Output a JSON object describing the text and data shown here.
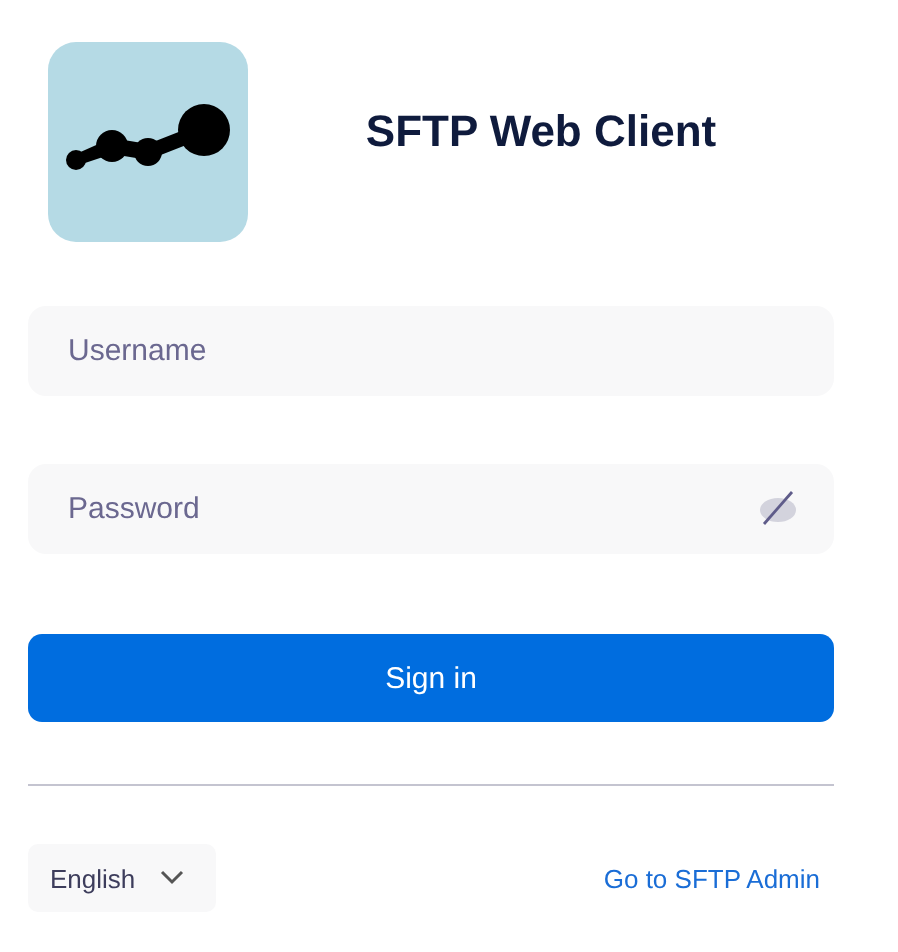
{
  "header": {
    "title": "SFTP Web Client"
  },
  "form": {
    "username": {
      "placeholder": "Username"
    },
    "password": {
      "placeholder": "Password",
      "visible": false
    },
    "submit": "Sign in"
  },
  "footer": {
    "language": "English",
    "admin_link": "Go to SFTP Admin"
  }
}
